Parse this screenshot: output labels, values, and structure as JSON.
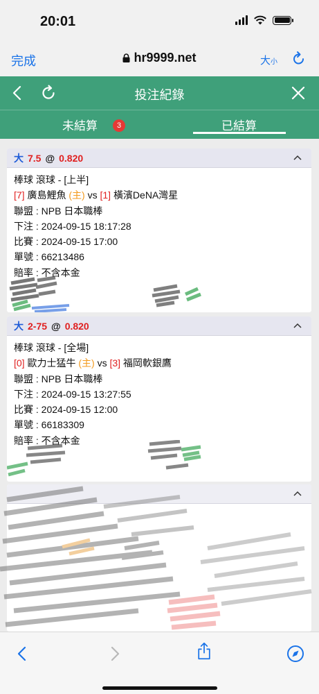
{
  "status_bar": {
    "time": "20:01"
  },
  "browser": {
    "done_label": "完成",
    "url": "hr9999.net",
    "text_size_big": "大",
    "text_size_small": "小"
  },
  "app": {
    "title": "投注紀錄",
    "tabs": {
      "unsettled": "未結算",
      "unsettled_badge": "3",
      "settled": "已結算"
    }
  },
  "bets": [
    {
      "bet_type": "大",
      "line": "7.5",
      "at": "@",
      "odds": "0.820",
      "sport_line": "棒球 滾球 - [上半]",
      "home_rank": "[7]",
      "home_team": "廣島鯉魚",
      "home_tag": "(主)",
      "vs": "vs",
      "away_rank": "[1]",
      "away_team": "橫濱DeNA灣星",
      "league": "聯盟 : NPB 日本職棒",
      "placed": "下注 : 2024-09-15 18:17:28",
      "match": "比賽 : 2024-09-15 17:00",
      "ticket": "單號 : 66213486",
      "odds_note": "賠率 : 不含本金"
    },
    {
      "bet_type": "大",
      "line": "2-75",
      "at": "@",
      "odds": "0.820",
      "sport_line": "棒球 滾球 - [全場]",
      "home_rank": "[0]",
      "home_team": "歐力士猛牛",
      "home_tag": "(主)",
      "vs": "vs",
      "away_rank": "[3]",
      "away_team": "福岡軟銀鷹",
      "league": "聯盟 : NPB 日本職棒",
      "placed": "下注 : 2024-09-15 13:27:55",
      "match": "比賽 : 2024-09-15 12:00",
      "ticket": "單號 : 66183309",
      "odds_note": "賠率 : 不含本金"
    }
  ],
  "colors": {
    "header_green": "#3fa07a",
    "accent_blue": "#1e5bd8",
    "accent_red": "#e02020",
    "home_orange": "#f39a1d",
    "badge_red": "#e53935"
  }
}
